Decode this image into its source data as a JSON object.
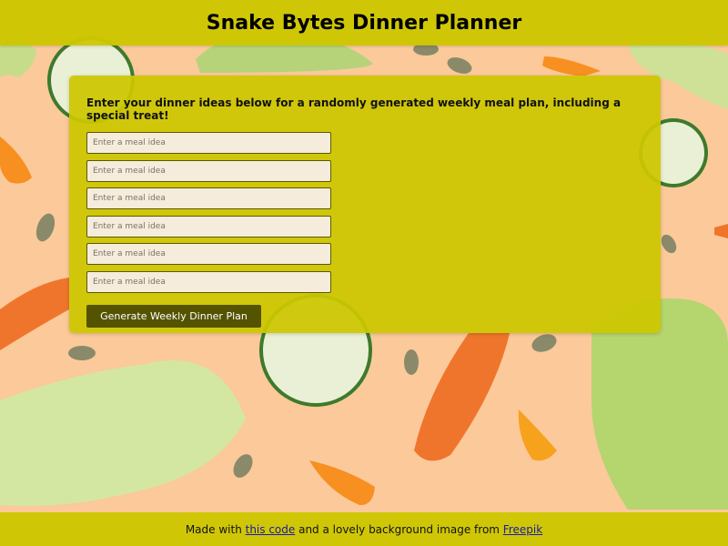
{
  "header": {
    "title": "Snake Bytes Dinner Planner"
  },
  "panel": {
    "intro": "Enter your dinner ideas below for a randomly generated weekly meal plan, including a special treat!",
    "meal_inputs": [
      {
        "placeholder": "Enter a meal idea",
        "value": ""
      },
      {
        "placeholder": "Enter a meal idea",
        "value": ""
      },
      {
        "placeholder": "Enter a meal idea",
        "value": ""
      },
      {
        "placeholder": "Enter a meal idea",
        "value": ""
      },
      {
        "placeholder": "Enter a meal idea",
        "value": ""
      },
      {
        "placeholder": "Enter a meal idea",
        "value": ""
      }
    ],
    "generate_label": "Generate Weekly Dinner Plan"
  },
  "footer": {
    "text_before": "Made with ",
    "code_link": "this code",
    "text_middle": " and a lovely background image from ",
    "image_link": "Freepik"
  },
  "colors": {
    "bar": "#cdc700",
    "panel": "#ccc700",
    "button": "#545300",
    "background": "#fbc99a"
  }
}
